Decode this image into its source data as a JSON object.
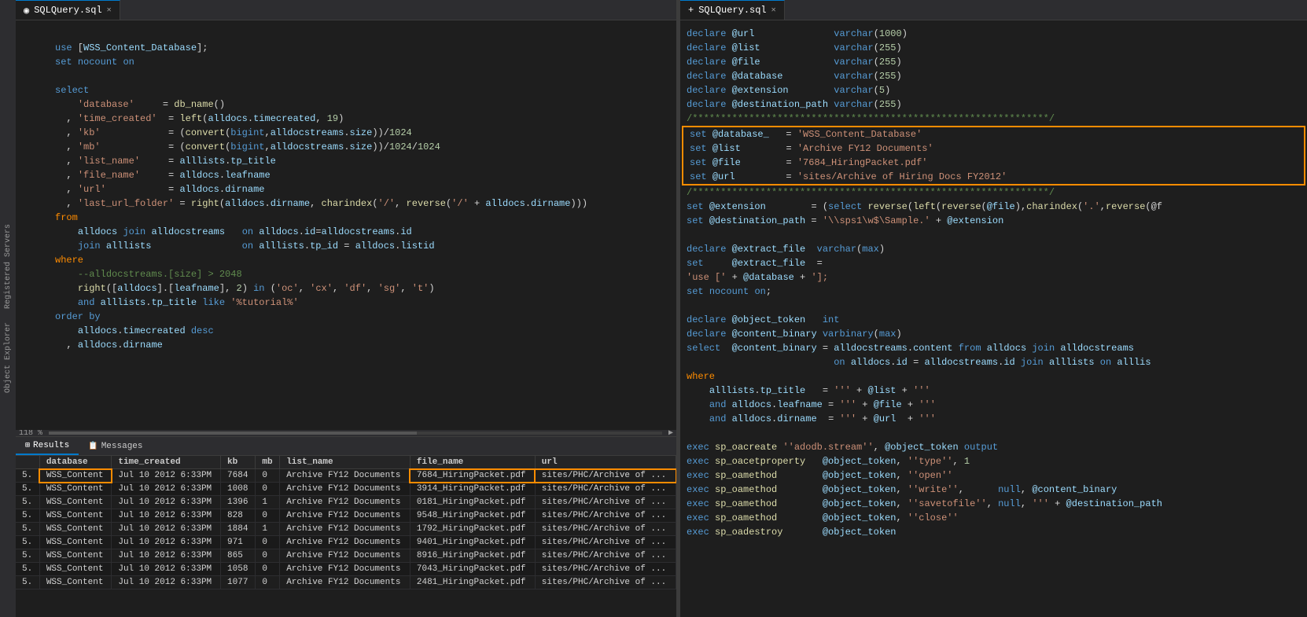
{
  "leftTab": {
    "label": "SQLQuery.sql",
    "pin": "◉",
    "close": "✕"
  },
  "rightTab": {
    "label": "SQLQuery.sql",
    "pin": "+",
    "close": "✕"
  },
  "leftCode": [
    {
      "num": "",
      "content": ""
    },
    {
      "num": "",
      "content": "use [WSS_Content_Database];"
    },
    {
      "num": "",
      "content": "set nocount on"
    },
    {
      "num": "",
      "content": ""
    },
    {
      "num": "",
      "content": "select"
    },
    {
      "num": "",
      "content": "    'database'     = db_name()"
    },
    {
      "num": "",
      "content": "  , 'time_created'  = left(alldocs.timecreated, 19)"
    },
    {
      "num": "",
      "content": "  , 'kb'            = (convert(bigint,alldocstreams.size))/1024"
    },
    {
      "num": "",
      "content": "  , 'mb'            = (convert(bigint,alldocstreams.size))/1024/1024"
    },
    {
      "num": "",
      "content": "  , 'list_name'     = alllists.tp_title"
    },
    {
      "num": "",
      "content": "  , 'file_name'     = alldocs.leafname"
    },
    {
      "num": "",
      "content": "  , 'url'           = alldocs.dirname"
    },
    {
      "num": "",
      "content": "  , 'last_url_folder' = right(alldocs.dirname, charindex('/', reverse('/' + alldocs.dirname))"
    },
    {
      "num": "",
      "content": "from"
    },
    {
      "num": "",
      "content": "    alldocs join alldocstreams   on alldocs.id=alldocstreams.id"
    },
    {
      "num": "",
      "content": "    join alllists                on alllists.tp_id = alldocs.listid"
    },
    {
      "num": "",
      "content": "where"
    },
    {
      "num": "",
      "content": "    --alldocstreams.[size] > 2048"
    },
    {
      "num": "",
      "content": "    right([alldocs].[leafname], 2) in ('oc', 'cx', 'df', 'sg', 't')"
    },
    {
      "num": "",
      "content": "    and alllists.tp_title like '%tutorial%'"
    },
    {
      "num": "",
      "content": "order by"
    },
    {
      "num": "",
      "content": "    alldocs.timecreated desc"
    },
    {
      "num": "",
      "content": "  , alldocs.dirname"
    }
  ],
  "rightCode": [
    "declare @url              varchar(1000)",
    "declare @list             varchar(255)",
    "declare @file             varchar(255)",
    "declare @database         varchar(255)",
    "declare @extension        varchar(5)",
    "declare @destination_path varchar(255)",
    "/***************************************************************/",
    "set @database_   = 'WSS_Content_Database'",
    "set @list        = 'Archive FY12 Documents'",
    "set @file        = '7684_HiringPacket.pdf'",
    "set @url         = 'sites/Archive of Hiring Docs FY2012'",
    "/***************************************************************/",
    "set @extension        = (select reverse(left(reverse(@file),charindex('.',reverse(@f",
    "set @destination_path = '\\\\sps1\\w$\\Sample.' + @extension",
    "",
    "declare @extract_file  varchar(max)",
    "set     @extract_file  =",
    "'use [' + @database + '];",
    "set nocount on;",
    "",
    "declare @object_token   int",
    "declare @content_binary varbinary(max)",
    "select  @content_binary = alldocstreams.content from alldocs join alldocstreams",
    "                          on alldocs.id = alldocstreams.id join alllists on alllis",
    "where",
    "    alllists.tp_title   = ''' + @list + '''",
    "    and alldocs.leafname = ''' + @file + '''",
    "    and alldocs.dirname  = ''' + @url  + '''",
    "",
    "exec sp_oacreate ''adodb.stream'', @object_token output",
    "exec sp_oacetproperty   @object_token, ''type'', 1",
    "exec sp_oamethod        @object_token, ''open''",
    "exec sp_oamethod        @object_token, ''write'',      null, @content_binary",
    "exec sp_oamethod        @object_token, ''savetofile'', null, ''' + @destination_path",
    "exec sp_oamethod        @object_token, ''close''",
    "exec sp_oadestroy       @object_token"
  ],
  "statusBar": {
    "zoom": "118 %"
  },
  "resultsTabs": [
    {
      "label": "Results",
      "icon": "⊞",
      "active": true
    },
    {
      "label": "Messages",
      "icon": "📋",
      "active": false
    }
  ],
  "tableHeaders": [
    "",
    "database",
    "time_created",
    "kb",
    "mb",
    "list_name",
    "file_name",
    "url"
  ],
  "tableRows": [
    [
      "5.",
      "WSS_Content",
      "Jul 10 2012 6:33PM",
      "7684",
      "0",
      "Archive FY12 Documents",
      "7684_HiringPacket.pdf",
      "sites/PHC/Archive of ..."
    ],
    [
      "5.",
      "WSS_Content",
      "Jul 10 2012 6:33PM",
      "1008",
      "0",
      "Archive FY12 Documents",
      "3914_HiringPacket.pdf",
      "sites/PHC/Archive of ..."
    ],
    [
      "5.",
      "WSS_Content",
      "Jul 10 2012 6:33PM",
      "1396",
      "1",
      "Archive FY12 Documents",
      "0181_HiringPacket.pdf",
      "sites/PHC/Archive of ..."
    ],
    [
      "5.",
      "WSS_Content",
      "Jul 10 2012 6:33PM",
      "828",
      "0",
      "Archive FY12 Documents",
      "9548_HiringPacket.pdf",
      "sites/PHC/Archive of ..."
    ],
    [
      "5.",
      "WSS_Content",
      "Jul 10 2012 6:33PM",
      "1884",
      "1",
      "Archive FY12 Documents",
      "1792_HiringPacket.pdf",
      "sites/PHC/Archive of ..."
    ],
    [
      "5.",
      "WSS_Content",
      "Jul 10 2012 6:33PM",
      "971",
      "0",
      "Archive FY12 Documents",
      "9401_HiringPacket.pdf",
      "sites/PHC/Archive of ..."
    ],
    [
      "5.",
      "WSS_Content",
      "Jul 10 2012 6:33PM",
      "865",
      "0",
      "Archive FY12 Documents",
      "8916_HiringPacket.pdf",
      "sites/PHC/Archive of ..."
    ],
    [
      "5.",
      "WSS_Content",
      "Jul 10 2012 6:33PM",
      "1058",
      "0",
      "Archive FY12 Documents",
      "7043_HiringPacket.pdf",
      "sites/PHC/Archive of ..."
    ],
    [
      "5.",
      "WSS_Content",
      "Jul 10 2012 6:33PM",
      "1077",
      "0",
      "Archive FY12 Documents",
      "2481_HiringPacket.pdf",
      "sites/PHC/Archive of ..."
    ]
  ],
  "highlightedRow": 0,
  "highlightedCells": [
    0,
    6,
    7
  ]
}
